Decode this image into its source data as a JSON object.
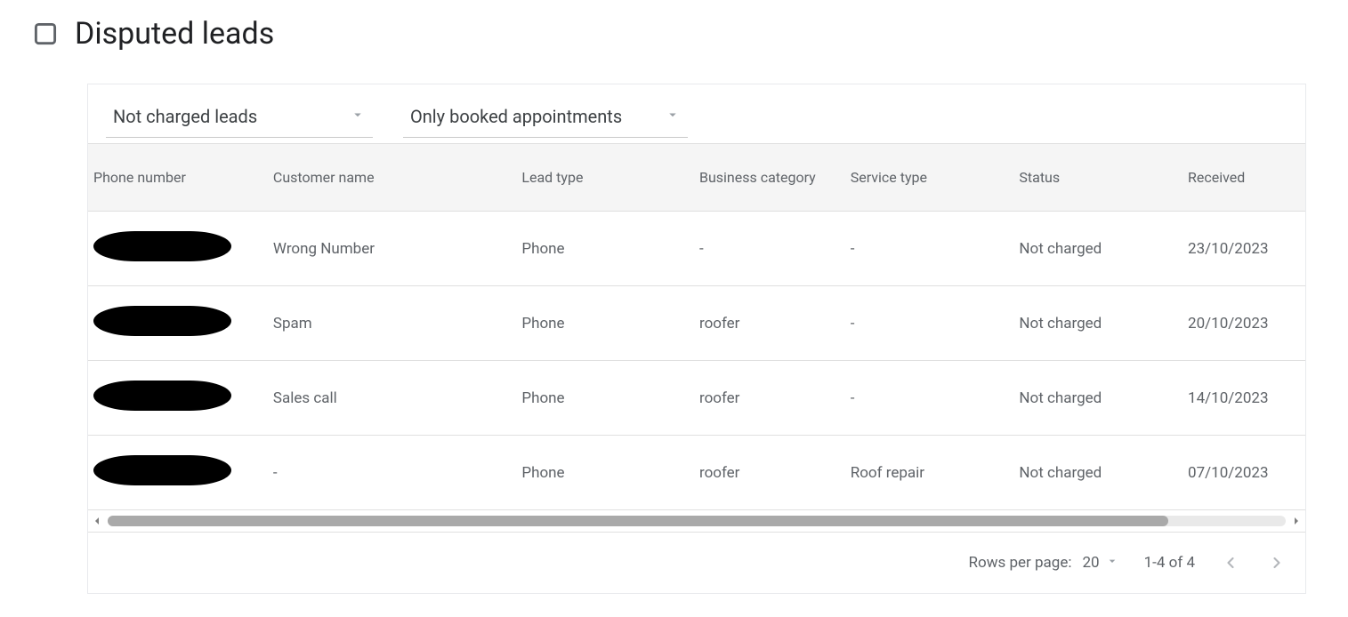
{
  "title": "Disputed leads",
  "filters": {
    "charge": {
      "selected": "Not charged leads"
    },
    "booking": {
      "selected": "Only booked appointments"
    }
  },
  "columns": {
    "phone": "Phone number",
    "name": "Customer name",
    "lead": "Lead type",
    "bus": "Business category",
    "svc": "Service type",
    "status": "Status",
    "recv": "Received"
  },
  "rows": [
    {
      "phone_redacted": true,
      "name": "Wrong Number",
      "lead": "Phone",
      "bus": "-",
      "svc": "-",
      "status": "Not charged",
      "recv": "23/10/2023"
    },
    {
      "phone_redacted": true,
      "name": "Spam",
      "lead": "Phone",
      "bus": "roofer",
      "svc": "-",
      "status": "Not charged",
      "recv": "20/10/2023"
    },
    {
      "phone_redacted": true,
      "name": "Sales call",
      "lead": "Phone",
      "bus": "roofer",
      "svc": "-",
      "status": "Not charged",
      "recv": "14/10/2023"
    },
    {
      "phone_redacted": true,
      "name": "-",
      "lead": "Phone",
      "bus": "roofer",
      "svc": "Roof repair",
      "status": "Not charged",
      "recv": "07/10/2023"
    }
  ],
  "pagination": {
    "rows_label": "Rows per page:",
    "rows_value": "20",
    "range": "1-4 of 4"
  }
}
